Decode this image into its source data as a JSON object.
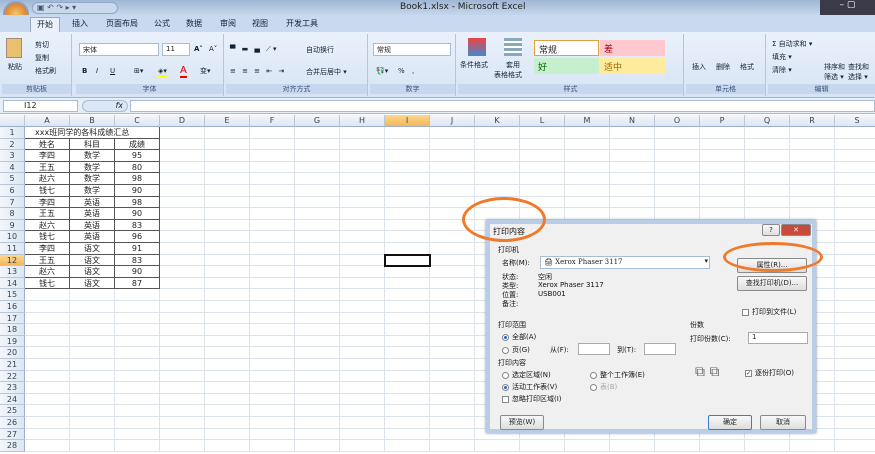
{
  "window": {
    "title": "Book1.xlsx - Microsoft Excel",
    "qat": "▣ ↶ ↷ ▸ ▾"
  },
  "tabs": [
    "开始",
    "插入",
    "页面布局",
    "公式",
    "数据",
    "审阅",
    "视图",
    "开发工具"
  ],
  "ribbon": {
    "clipboard": {
      "paste": "粘贴",
      "cut": "剪切",
      "copy": "复制",
      "format_painter": "格式刷",
      "label": "剪贴板"
    },
    "font": {
      "name": "宋体",
      "size": "11",
      "grow": "A˄",
      "shrink": "A˅",
      "bold": "B",
      "italic": "I",
      "underline": "U",
      "label": "字体"
    },
    "align": {
      "wrap": "自动换行",
      "merge": "合并后居中 ▾",
      "label": "对齐方式"
    },
    "number": {
      "format": "常规",
      "percent": "%",
      "comma": ",",
      "label": "数字"
    },
    "styles": {
      "cond": "条件格式",
      "table": "套用",
      "table2": "表格格式",
      "normal": "常规",
      "bad": "差",
      "good": "好",
      "neutral": "适中",
      "label": "样式",
      "normal_color": "#ffffff",
      "bad_color": "#ffc7ce",
      "good_color": "#c6efce",
      "neutral_color": "#ffeb9c"
    },
    "cells": {
      "insert": "插入",
      "delete": "删除",
      "format": "格式",
      "label": "单元格"
    },
    "editing": {
      "autosum": "Σ 自动求和 ▾",
      "fill": "填充 ▾",
      "clear": "清除 ▾",
      "sort": "排序和",
      "sort2": "筛选 ▾",
      "find": "查找和",
      "find2": "选择 ▾",
      "label": "编辑"
    }
  },
  "formula_bar": {
    "name_box": "I12",
    "fx": "fx",
    "value": ""
  },
  "sheet": {
    "columns": [
      "A",
      "B",
      "C",
      "D",
      "E",
      "F",
      "G",
      "H",
      "I",
      "J",
      "K",
      "L",
      "M",
      "N",
      "O",
      "P",
      "Q",
      "R",
      "S"
    ],
    "selected_cell": "I12",
    "title": "xxx班同学的各科成绩汇总",
    "header": [
      "姓名",
      "科目",
      "成绩"
    ],
    "rows": [
      [
        "李四",
        "数学",
        "95"
      ],
      [
        "王五",
        "数学",
        "80"
      ],
      [
        "赵六",
        "数学",
        "98"
      ],
      [
        "钱七",
        "数学",
        "90"
      ],
      [
        "李四",
        "英语",
        "98"
      ],
      [
        "王五",
        "英语",
        "90"
      ],
      [
        "赵六",
        "英语",
        "83"
      ],
      [
        "钱七",
        "英语",
        "96"
      ],
      [
        "李四",
        "语文",
        "91"
      ],
      [
        "王五",
        "语文",
        "83"
      ],
      [
        "赵六",
        "语文",
        "90"
      ],
      [
        "钱七",
        "语文",
        "87"
      ]
    ]
  },
  "dialog": {
    "title": "打印内容",
    "help": "?",
    "close": "✕",
    "printer_group": "打印机",
    "name_label": "名称(M):",
    "printer_name": "Xerox Phaser 3117",
    "status_label": "状态:",
    "status": "空闲",
    "type_label": "类型:",
    "type": "Xerox Phaser 3117",
    "where_label": "位置:",
    "where": "USB001",
    "comment_label": "备注:",
    "properties": "属性(R)...",
    "find_printer": "查找打印机(D)...",
    "print_to_file": "打印到文件(L)",
    "range_group": "打印范围",
    "all": "全部(A)",
    "pages": "页(G)",
    "from": "从(F):",
    "to": "到(T):",
    "what_group": "打印内容",
    "selection": "选定区域(N)",
    "whole_workbook": "整个工作簿(E)",
    "active_sheets": "活动工作表(V)",
    "table": "表(B)",
    "ignore_area": "忽略打印区域(I)",
    "copies_group": "份数",
    "copies_label": "打印份数(C):",
    "copies": "1",
    "collate": "逐份打印(O)",
    "preview": "预览(W)",
    "ok": "确定",
    "cancel": "取消"
  }
}
